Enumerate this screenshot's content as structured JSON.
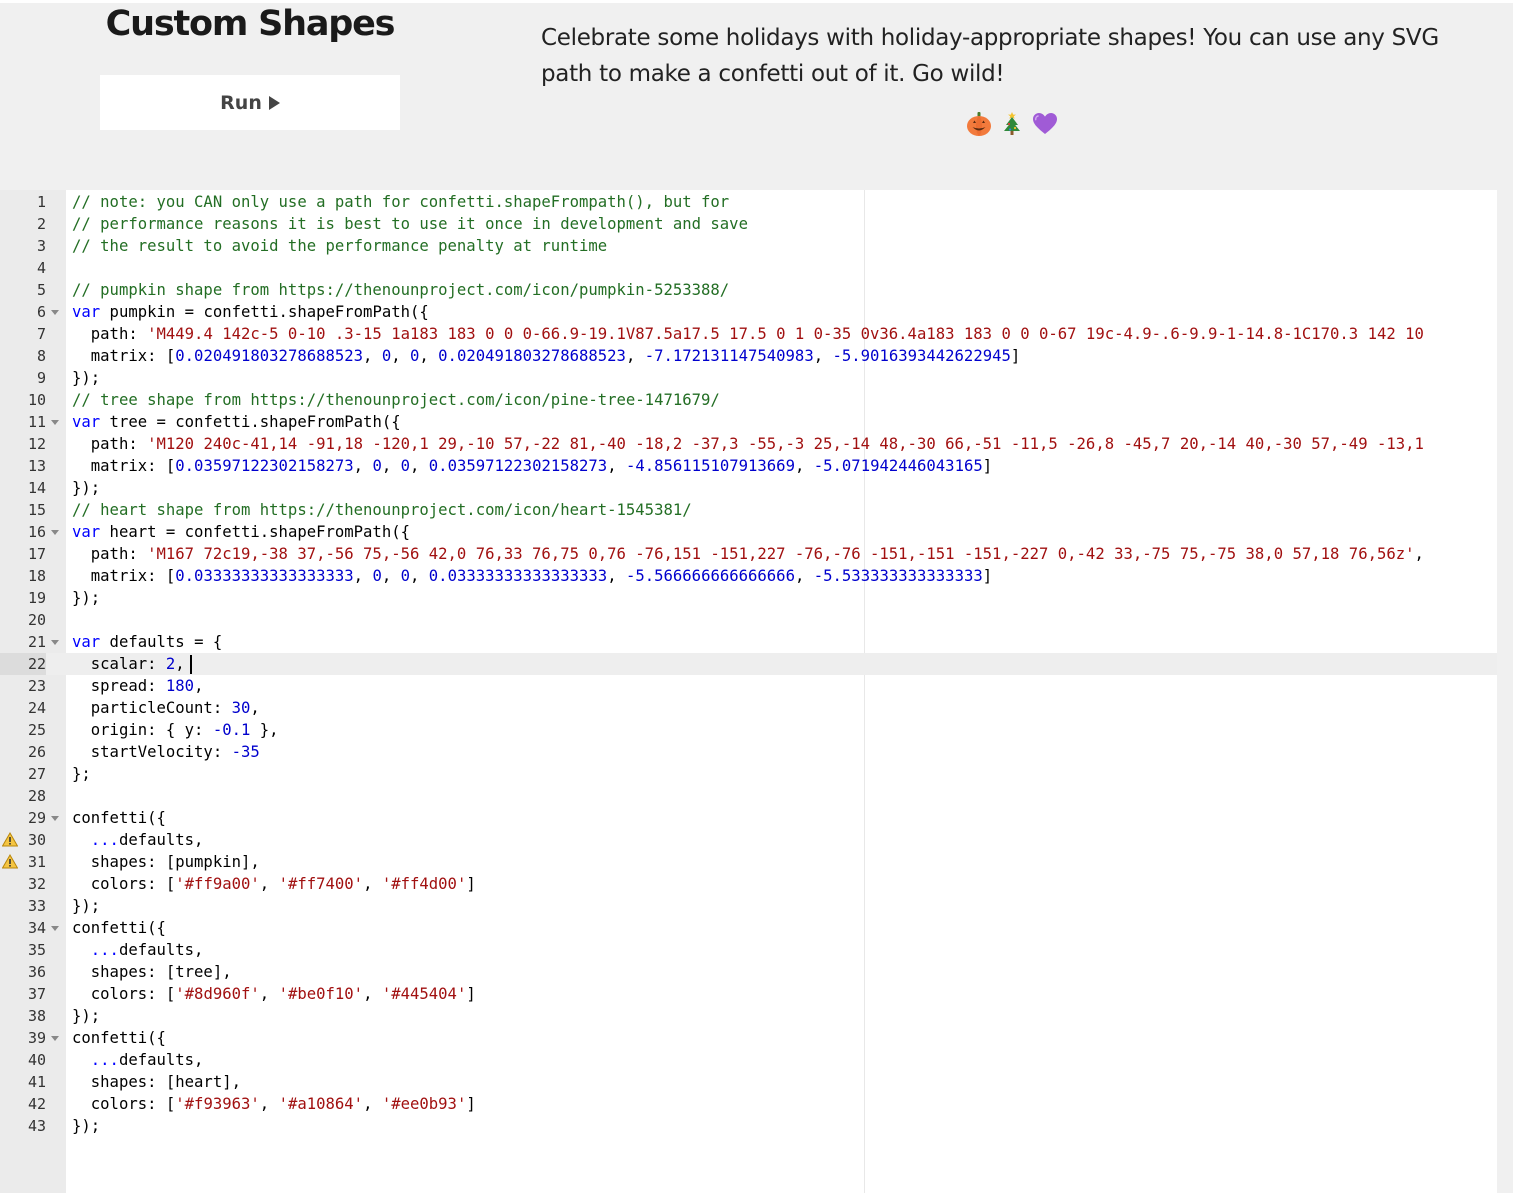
{
  "header": {
    "title": "Custom Shapes",
    "run_label": "Run",
    "description": "Celebrate some holidays with holiday-appropriate shapes! You can use any SVG path to make a confetti out of it. Go wild!",
    "emojis": [
      "pumpkin-emoji",
      "christmas-tree-emoji",
      "purple-heart-emoji"
    ]
  },
  "editor": {
    "active_line": 22,
    "warning_lines": [
      30,
      31
    ],
    "fold_lines": [
      6,
      11,
      16,
      21,
      29,
      34,
      39
    ],
    "lines": [
      [
        [
          "cm",
          "// note: you CAN only use a path for confetti.shapeFrompath(), but for"
        ]
      ],
      [
        [
          "cm",
          "// performance reasons it is best to use it once in development and save"
        ]
      ],
      [
        [
          "cm",
          "// the result to avoid the performance penalty at runtime"
        ]
      ],
      [],
      [
        [
          "cm",
          "// pumpkin shape from https://thenounproject.com/icon/pumpkin-5253388/"
        ]
      ],
      [
        [
          "kw",
          "var"
        ],
        [
          "",
          " pumpkin "
        ],
        [
          "",
          "="
        ],
        [
          "",
          " confetti.shapeFromPath({"
        ]
      ],
      [
        [
          "",
          "  path: "
        ],
        [
          "str",
          "'M449.4 142c-5 0-10 .3-15 1a183 183 0 0 0-66.9-19.1V87.5a17.5 17.5 0 1 0-35 0v36.4a183 183 0 0 0-67 19c-4.9-.6-9.9-1-14.8-1C170.3 142 10"
        ]
      ],
      [
        [
          "",
          "  matrix: ["
        ],
        [
          "num",
          "0.020491803278688523"
        ],
        [
          "",
          ", "
        ],
        [
          "num",
          "0"
        ],
        [
          "",
          ", "
        ],
        [
          "num",
          "0"
        ],
        [
          "",
          ", "
        ],
        [
          "num",
          "0.020491803278688523"
        ],
        [
          "",
          ", "
        ],
        [
          "num",
          "-7.172131147540983"
        ],
        [
          "",
          ", "
        ],
        [
          "num",
          "-5.9016393442622945"
        ],
        [
          "",
          "]"
        ]
      ],
      [
        [
          "",
          "});"
        ]
      ],
      [
        [
          "cm",
          "// tree shape from https://thenounproject.com/icon/pine-tree-1471679/"
        ]
      ],
      [
        [
          "kw",
          "var"
        ],
        [
          "",
          " tree "
        ],
        [
          "",
          "="
        ],
        [
          "",
          " confetti.shapeFromPath({"
        ]
      ],
      [
        [
          "",
          "  path: "
        ],
        [
          "str",
          "'M120 240c-41,14 -91,18 -120,1 29,-10 57,-22 81,-40 -18,2 -37,3 -55,-3 25,-14 48,-30 66,-51 -11,5 -26,8 -45,7 20,-14 40,-30 57,-49 -13,1"
        ]
      ],
      [
        [
          "",
          "  matrix: ["
        ],
        [
          "num",
          "0.03597122302158273"
        ],
        [
          "",
          ", "
        ],
        [
          "num",
          "0"
        ],
        [
          "",
          ", "
        ],
        [
          "num",
          "0"
        ],
        [
          "",
          ", "
        ],
        [
          "num",
          "0.03597122302158273"
        ],
        [
          "",
          ", "
        ],
        [
          "num",
          "-4.856115107913669"
        ],
        [
          "",
          ", "
        ],
        [
          "num",
          "-5.071942446043165"
        ],
        [
          "",
          "]"
        ]
      ],
      [
        [
          "",
          "});"
        ]
      ],
      [
        [
          "cm",
          "// heart shape from https://thenounproject.com/icon/heart-1545381/"
        ]
      ],
      [
        [
          "kw",
          "var"
        ],
        [
          "",
          " heart "
        ],
        [
          "",
          "="
        ],
        [
          "",
          " confetti.shapeFromPath({"
        ]
      ],
      [
        [
          "",
          "  path: "
        ],
        [
          "str",
          "'M167 72c19,-38 37,-56 75,-56 42,0 76,33 76,75 0,76 -76,151 -151,227 -76,-76 -151,-151 -151,-227 0,-42 33,-75 75,-75 38,0 57,18 76,56z'"
        ],
        [
          "",
          ","
        ]
      ],
      [
        [
          "",
          "  matrix: ["
        ],
        [
          "num",
          "0.03333333333333333"
        ],
        [
          "",
          ", "
        ],
        [
          "num",
          "0"
        ],
        [
          "",
          ", "
        ],
        [
          "num",
          "0"
        ],
        [
          "",
          ", "
        ],
        [
          "num",
          "0.03333333333333333"
        ],
        [
          "",
          ", "
        ],
        [
          "num",
          "-5.566666666666666"
        ],
        [
          "",
          ", "
        ],
        [
          "num",
          "-5.533333333333333"
        ],
        [
          "",
          "]"
        ]
      ],
      [
        [
          "",
          "});"
        ]
      ],
      [],
      [
        [
          "kw",
          "var"
        ],
        [
          "",
          " defaults "
        ],
        [
          "",
          "="
        ],
        [
          "",
          " {"
        ]
      ],
      [
        [
          "",
          "  scalar: "
        ],
        [
          "num",
          "2"
        ],
        [
          "",
          ","
        ]
      ],
      [
        [
          "",
          "  spread: "
        ],
        [
          "num",
          "180"
        ],
        [
          "",
          ","
        ]
      ],
      [
        [
          "",
          "  particleCount: "
        ],
        [
          "num",
          "30"
        ],
        [
          "",
          ","
        ]
      ],
      [
        [
          "",
          "  origin: { y: "
        ],
        [
          "num",
          "-0.1"
        ],
        [
          "",
          " },"
        ]
      ],
      [
        [
          "",
          "  startVelocity: "
        ],
        [
          "num",
          "-35"
        ]
      ],
      [
        [
          "",
          "};"
        ]
      ],
      [],
      [
        [
          "",
          "confetti({"
        ]
      ],
      [
        [
          "",
          "  "
        ],
        [
          "kw",
          "..."
        ],
        [
          "",
          "defaults,"
        ]
      ],
      [
        [
          "",
          "  shapes: [pumpkin],"
        ]
      ],
      [
        [
          "",
          "  colors: ["
        ],
        [
          "str",
          "'#ff9a00'"
        ],
        [
          "",
          ", "
        ],
        [
          "str",
          "'#ff7400'"
        ],
        [
          "",
          ", "
        ],
        [
          "str",
          "'#ff4d00'"
        ],
        [
          "",
          "]"
        ]
      ],
      [
        [
          "",
          "});"
        ]
      ],
      [
        [
          "",
          "confetti({"
        ]
      ],
      [
        [
          "",
          "  "
        ],
        [
          "kw",
          "..."
        ],
        [
          "",
          "defaults,"
        ]
      ],
      [
        [
          "",
          "  shapes: [tree],"
        ]
      ],
      [
        [
          "",
          "  colors: ["
        ],
        [
          "str",
          "'#8d960f'"
        ],
        [
          "",
          ", "
        ],
        [
          "str",
          "'#be0f10'"
        ],
        [
          "",
          ", "
        ],
        [
          "str",
          "'#445404'"
        ],
        [
          "",
          "]"
        ]
      ],
      [
        [
          "",
          "});"
        ]
      ],
      [
        [
          "",
          "confetti({"
        ]
      ],
      [
        [
          "",
          "  "
        ],
        [
          "kw",
          "..."
        ],
        [
          "",
          "defaults,"
        ]
      ],
      [
        [
          "",
          "  shapes: [heart],"
        ]
      ],
      [
        [
          "",
          "  colors: ["
        ],
        [
          "str",
          "'#f93963'"
        ],
        [
          "",
          ", "
        ],
        [
          "str",
          "'#a10864'"
        ],
        [
          "",
          ", "
        ],
        [
          "str",
          "'#ee0b93'"
        ],
        [
          "",
          "]"
        ]
      ],
      [
        [
          "",
          "});"
        ]
      ]
    ]
  }
}
